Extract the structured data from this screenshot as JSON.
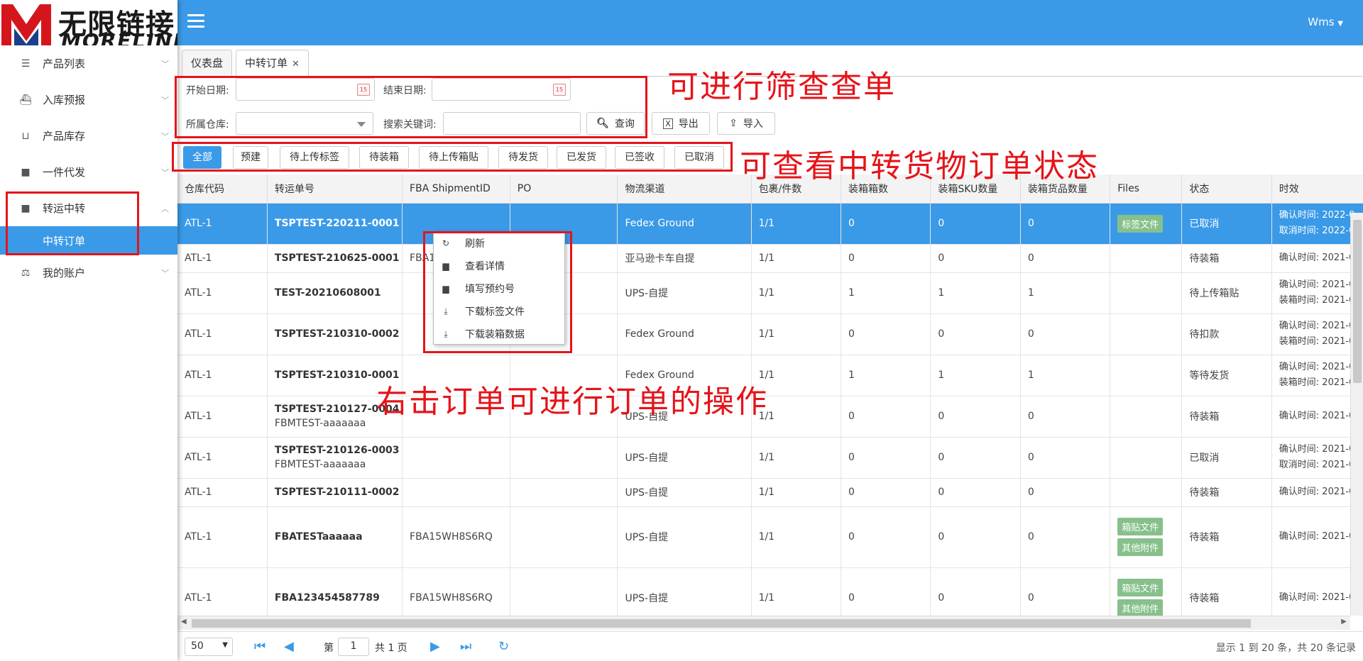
{
  "logo": {
    "cn": "无限链接",
    "en": "MORELINK",
    "mark": "M"
  },
  "colors": {
    "primary": "#3a9ae8",
    "annotation": "#e5141a",
    "file_button": "#86c08a"
  },
  "header": {
    "user": "Wms",
    "menu_icon": "hamburger-icon"
  },
  "sidebar": {
    "items": [
      {
        "label": "产品列表",
        "icon": "list-icon"
      },
      {
        "label": "入库预报",
        "icon": "ship-icon"
      },
      {
        "label": "产品库存",
        "icon": "inbox-icon"
      },
      {
        "label": "一件代发",
        "icon": "truck-icon"
      },
      {
        "label": "转运中转",
        "icon": "truck-icon",
        "expanded": true
      },
      {
        "label": "中转订单",
        "icon": "",
        "sub": true,
        "selected": true
      },
      {
        "label": "我的账户",
        "icon": "balance-icon"
      }
    ]
  },
  "tabs": [
    {
      "label": "仪表盘"
    },
    {
      "label": "中转订单",
      "closable": true,
      "active": true
    }
  ],
  "filters": {
    "start_date": "开始日期:",
    "end_date": "结束日期:",
    "warehouse": "所属仓库:",
    "keyword": "搜索关键词:",
    "query": "查询",
    "export": "导出",
    "import": "导入",
    "start_value": "",
    "end_value": "",
    "warehouse_value": "",
    "keyword_value": ""
  },
  "status_tabs": [
    "全部",
    "预建",
    "待上传标签",
    "待装箱",
    "待上传箱贴",
    "待发货",
    "已发货",
    "已签收",
    "已取消"
  ],
  "annotations": {
    "filter": "可进行筛查查单",
    "status": "可查看中转货物订单状态",
    "context": "右击订单可进行订单的操作"
  },
  "context_menu": [
    {
      "label": "刷新",
      "icon": "refresh-icon"
    },
    {
      "label": "查看详情",
      "icon": "book-icon"
    },
    {
      "label": "填写预约号",
      "icon": "book-icon"
    },
    {
      "label": "下载标签文件",
      "icon": "download-icon"
    },
    {
      "label": "下载装箱数据",
      "icon": "download-icon"
    }
  ],
  "table": {
    "columns": [
      "仓库代码",
      "转运单号",
      "FBA ShipmentID",
      "PO",
      "物流渠道",
      "包裹/件数",
      "装箱箱数",
      "装箱SKU数量",
      "装箱货品数量",
      "Files",
      "状态",
      "时效"
    ],
    "rows": [
      {
        "wh": "ATL-1",
        "no": "TSPTEST-220211-0001",
        "no2": "",
        "fba": "",
        "po": "",
        "ch": "Fedex Ground",
        "pk": "1/1",
        "box": "0",
        "sku": "0",
        "qty": "0",
        "files": [
          "标签文件"
        ],
        "status": "已取消",
        "t1": "确认时间: 2022-0",
        "t2": "取消时间: 2022-0",
        "selected": true
      },
      {
        "wh": "ATL-1",
        "no": "TSPTEST-210625-0001",
        "no2": "",
        "fba": "FBA1",
        "po": "",
        "ch": "亚马逊卡车自提",
        "pk": "1/1",
        "box": "0",
        "sku": "0",
        "qty": "0",
        "files": [],
        "status": "待装箱",
        "t1": "确认时间: 2021-0",
        "t2": ""
      },
      {
        "wh": "ATL-1",
        "no": "TEST-20210608001",
        "no2": "",
        "fba": "",
        "po": "",
        "ch": "UPS-自提",
        "pk": "1/1",
        "box": "1",
        "sku": "1",
        "qty": "1",
        "files": [],
        "status": "待上传箱贴",
        "t1": "确认时间: 2021-0",
        "t2": "装箱时间: 2021-0"
      },
      {
        "wh": "ATL-1",
        "no": "TSPTEST-210310-0002",
        "no2": "",
        "fba": "",
        "po": "",
        "ch": "Fedex Ground",
        "pk": "1/1",
        "box": "0",
        "sku": "0",
        "qty": "0",
        "files": [],
        "status": "待扣款",
        "t1": "确认时间: 2021-0",
        "t2": "装箱时间: 2021-0"
      },
      {
        "wh": "ATL-1",
        "no": "TSPTEST-210310-0001",
        "no2": "",
        "fba": "",
        "po": "",
        "ch": "Fedex Ground",
        "pk": "1/1",
        "box": "1",
        "sku": "1",
        "qty": "1",
        "files": [],
        "status": "等待发货",
        "t1": "确认时间: 2021-0",
        "t2": "装箱时间: 2021-0"
      },
      {
        "wh": "ATL-1",
        "no": "TSPTEST-210127-0004",
        "no2": "FBMTEST-aaaaaaa",
        "fba": "",
        "po": "",
        "ch": "UPS-自提",
        "pk": "1/1",
        "box": "0",
        "sku": "0",
        "qty": "0",
        "files": [],
        "status": "待装箱",
        "t1": "确认时间: 2021-0",
        "t2": ""
      },
      {
        "wh": "ATL-1",
        "no": "TSPTEST-210126-0003",
        "no2": "FBMTEST-aaaaaaa",
        "fba": "",
        "po": "",
        "ch": "UPS-自提",
        "pk": "1/1",
        "box": "0",
        "sku": "0",
        "qty": "0",
        "files": [],
        "status": "已取消",
        "t1": "确认时间: 2021-0",
        "t2": "取消时间: 2021-0"
      },
      {
        "wh": "ATL-1",
        "no": "TSPTEST-210111-0002",
        "no2": "",
        "fba": "",
        "po": "",
        "ch": "UPS-自提",
        "pk": "1/1",
        "box": "0",
        "sku": "0",
        "qty": "0",
        "files": [],
        "status": "待装箱",
        "t1": "确认时间: 2021-0",
        "t2": ""
      },
      {
        "wh": "ATL-1",
        "no": "FBATESTaaaaaa",
        "no2": "",
        "fba": "FBA15WH8S6RQ",
        "po": "",
        "ch": "UPS-自提",
        "pk": "1/1",
        "box": "0",
        "sku": "0",
        "qty": "0",
        "files": [
          "箱贴文件",
          "其他附件"
        ],
        "status": "待装箱",
        "t1": "确认时间: 2021-0",
        "t2": ""
      },
      {
        "wh": "ATL-1",
        "no": "FBA123454587789",
        "no2": "",
        "fba": "FBA15WH8S6RQ",
        "po": "",
        "ch": "UPS-自提",
        "pk": "1/1",
        "box": "0",
        "sku": "0",
        "qty": "0",
        "files": [
          "箱贴文件",
          "其他附件"
        ],
        "status": "待装箱",
        "t1": "确认时间: 2021-0",
        "t2": ""
      }
    ]
  },
  "pager": {
    "page_size": "50",
    "page_prefix": "第",
    "page": "1",
    "page_total": "共 1 页",
    "summary": "显示 1 到 20 条，共 20 条记录"
  }
}
